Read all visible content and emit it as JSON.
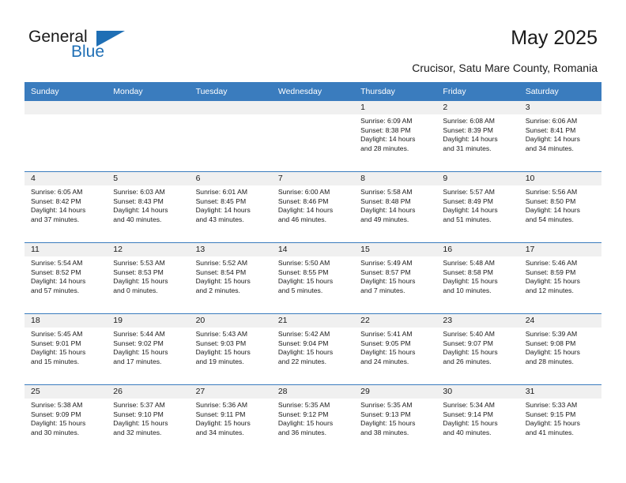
{
  "brand": {
    "name_part1": "General",
    "name_part2": "Blue",
    "accent_color": "#1f6fb5"
  },
  "header": {
    "title": "May 2025",
    "subtitle": "Crucisor, Satu Mare County, Romania"
  },
  "calendar": {
    "header_color": "#3a7cbe",
    "daynum_band_color": "#f0f0f0",
    "weekday_headers": [
      "Sunday",
      "Monday",
      "Tuesday",
      "Wednesday",
      "Thursday",
      "Friday",
      "Saturday"
    ],
    "weeks": [
      [
        {
          "day": "",
          "sunrise": "",
          "sunset": "",
          "daylight_line1": "",
          "daylight_line2": ""
        },
        {
          "day": "",
          "sunrise": "",
          "sunset": "",
          "daylight_line1": "",
          "daylight_line2": ""
        },
        {
          "day": "",
          "sunrise": "",
          "sunset": "",
          "daylight_line1": "",
          "daylight_line2": ""
        },
        {
          "day": "",
          "sunrise": "",
          "sunset": "",
          "daylight_line1": "",
          "daylight_line2": ""
        },
        {
          "day": "1",
          "sunrise": "Sunrise: 6:09 AM",
          "sunset": "Sunset: 8:38 PM",
          "daylight_line1": "Daylight: 14 hours",
          "daylight_line2": "and 28 minutes."
        },
        {
          "day": "2",
          "sunrise": "Sunrise: 6:08 AM",
          "sunset": "Sunset: 8:39 PM",
          "daylight_line1": "Daylight: 14 hours",
          "daylight_line2": "and 31 minutes."
        },
        {
          "day": "3",
          "sunrise": "Sunrise: 6:06 AM",
          "sunset": "Sunset: 8:41 PM",
          "daylight_line1": "Daylight: 14 hours",
          "daylight_line2": "and 34 minutes."
        }
      ],
      [
        {
          "day": "4",
          "sunrise": "Sunrise: 6:05 AM",
          "sunset": "Sunset: 8:42 PM",
          "daylight_line1": "Daylight: 14 hours",
          "daylight_line2": "and 37 minutes."
        },
        {
          "day": "5",
          "sunrise": "Sunrise: 6:03 AM",
          "sunset": "Sunset: 8:43 PM",
          "daylight_line1": "Daylight: 14 hours",
          "daylight_line2": "and 40 minutes."
        },
        {
          "day": "6",
          "sunrise": "Sunrise: 6:01 AM",
          "sunset": "Sunset: 8:45 PM",
          "daylight_line1": "Daylight: 14 hours",
          "daylight_line2": "and 43 minutes."
        },
        {
          "day": "7",
          "sunrise": "Sunrise: 6:00 AM",
          "sunset": "Sunset: 8:46 PM",
          "daylight_line1": "Daylight: 14 hours",
          "daylight_line2": "and 46 minutes."
        },
        {
          "day": "8",
          "sunrise": "Sunrise: 5:58 AM",
          "sunset": "Sunset: 8:48 PM",
          "daylight_line1": "Daylight: 14 hours",
          "daylight_line2": "and 49 minutes."
        },
        {
          "day": "9",
          "sunrise": "Sunrise: 5:57 AM",
          "sunset": "Sunset: 8:49 PM",
          "daylight_line1": "Daylight: 14 hours",
          "daylight_line2": "and 51 minutes."
        },
        {
          "day": "10",
          "sunrise": "Sunrise: 5:56 AM",
          "sunset": "Sunset: 8:50 PM",
          "daylight_line1": "Daylight: 14 hours",
          "daylight_line2": "and 54 minutes."
        }
      ],
      [
        {
          "day": "11",
          "sunrise": "Sunrise: 5:54 AM",
          "sunset": "Sunset: 8:52 PM",
          "daylight_line1": "Daylight: 14 hours",
          "daylight_line2": "and 57 minutes."
        },
        {
          "day": "12",
          "sunrise": "Sunrise: 5:53 AM",
          "sunset": "Sunset: 8:53 PM",
          "daylight_line1": "Daylight: 15 hours",
          "daylight_line2": "and 0 minutes."
        },
        {
          "day": "13",
          "sunrise": "Sunrise: 5:52 AM",
          "sunset": "Sunset: 8:54 PM",
          "daylight_line1": "Daylight: 15 hours",
          "daylight_line2": "and 2 minutes."
        },
        {
          "day": "14",
          "sunrise": "Sunrise: 5:50 AM",
          "sunset": "Sunset: 8:55 PM",
          "daylight_line1": "Daylight: 15 hours",
          "daylight_line2": "and 5 minutes."
        },
        {
          "day": "15",
          "sunrise": "Sunrise: 5:49 AM",
          "sunset": "Sunset: 8:57 PM",
          "daylight_line1": "Daylight: 15 hours",
          "daylight_line2": "and 7 minutes."
        },
        {
          "day": "16",
          "sunrise": "Sunrise: 5:48 AM",
          "sunset": "Sunset: 8:58 PM",
          "daylight_line1": "Daylight: 15 hours",
          "daylight_line2": "and 10 minutes."
        },
        {
          "day": "17",
          "sunrise": "Sunrise: 5:46 AM",
          "sunset": "Sunset: 8:59 PM",
          "daylight_line1": "Daylight: 15 hours",
          "daylight_line2": "and 12 minutes."
        }
      ],
      [
        {
          "day": "18",
          "sunrise": "Sunrise: 5:45 AM",
          "sunset": "Sunset: 9:01 PM",
          "daylight_line1": "Daylight: 15 hours",
          "daylight_line2": "and 15 minutes."
        },
        {
          "day": "19",
          "sunrise": "Sunrise: 5:44 AM",
          "sunset": "Sunset: 9:02 PM",
          "daylight_line1": "Daylight: 15 hours",
          "daylight_line2": "and 17 minutes."
        },
        {
          "day": "20",
          "sunrise": "Sunrise: 5:43 AM",
          "sunset": "Sunset: 9:03 PM",
          "daylight_line1": "Daylight: 15 hours",
          "daylight_line2": "and 19 minutes."
        },
        {
          "day": "21",
          "sunrise": "Sunrise: 5:42 AM",
          "sunset": "Sunset: 9:04 PM",
          "daylight_line1": "Daylight: 15 hours",
          "daylight_line2": "and 22 minutes."
        },
        {
          "day": "22",
          "sunrise": "Sunrise: 5:41 AM",
          "sunset": "Sunset: 9:05 PM",
          "daylight_line1": "Daylight: 15 hours",
          "daylight_line2": "and 24 minutes."
        },
        {
          "day": "23",
          "sunrise": "Sunrise: 5:40 AM",
          "sunset": "Sunset: 9:07 PM",
          "daylight_line1": "Daylight: 15 hours",
          "daylight_line2": "and 26 minutes."
        },
        {
          "day": "24",
          "sunrise": "Sunrise: 5:39 AM",
          "sunset": "Sunset: 9:08 PM",
          "daylight_line1": "Daylight: 15 hours",
          "daylight_line2": "and 28 minutes."
        }
      ],
      [
        {
          "day": "25",
          "sunrise": "Sunrise: 5:38 AM",
          "sunset": "Sunset: 9:09 PM",
          "daylight_line1": "Daylight: 15 hours",
          "daylight_line2": "and 30 minutes."
        },
        {
          "day": "26",
          "sunrise": "Sunrise: 5:37 AM",
          "sunset": "Sunset: 9:10 PM",
          "daylight_line1": "Daylight: 15 hours",
          "daylight_line2": "and 32 minutes."
        },
        {
          "day": "27",
          "sunrise": "Sunrise: 5:36 AM",
          "sunset": "Sunset: 9:11 PM",
          "daylight_line1": "Daylight: 15 hours",
          "daylight_line2": "and 34 minutes."
        },
        {
          "day": "28",
          "sunrise": "Sunrise: 5:35 AM",
          "sunset": "Sunset: 9:12 PM",
          "daylight_line1": "Daylight: 15 hours",
          "daylight_line2": "and 36 minutes."
        },
        {
          "day": "29",
          "sunrise": "Sunrise: 5:35 AM",
          "sunset": "Sunset: 9:13 PM",
          "daylight_line1": "Daylight: 15 hours",
          "daylight_line2": "and 38 minutes."
        },
        {
          "day": "30",
          "sunrise": "Sunrise: 5:34 AM",
          "sunset": "Sunset: 9:14 PM",
          "daylight_line1": "Daylight: 15 hours",
          "daylight_line2": "and 40 minutes."
        },
        {
          "day": "31",
          "sunrise": "Sunrise: 5:33 AM",
          "sunset": "Sunset: 9:15 PM",
          "daylight_line1": "Daylight: 15 hours",
          "daylight_line2": "and 41 minutes."
        }
      ]
    ]
  }
}
